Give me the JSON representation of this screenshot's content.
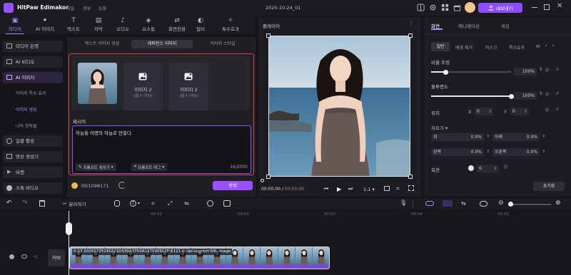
{
  "app": {
    "title": "HitPaw Edimakor",
    "menu": [
      "파일",
      "생성",
      "도움"
    ],
    "project_name": "2025-10-24_01",
    "export_label": "내보내기"
  },
  "toolbar": {
    "tools": [
      {
        "label": "미디어",
        "icon": "media-icon",
        "active": true
      },
      {
        "label": "AI 이미지",
        "icon": "ai-image-icon"
      },
      {
        "label": "텍스트",
        "icon": "text-icon"
      },
      {
        "label": "자막",
        "icon": "subtitle-icon"
      },
      {
        "label": "오디오",
        "icon": "audio-icon"
      },
      {
        "label": "요소들",
        "icon": "elements-icon"
      },
      {
        "label": "화면전환",
        "icon": "transition-icon"
      },
      {
        "label": "필터",
        "icon": "filter-icon"
      },
      {
        "label": "특수효과",
        "icon": "effects-icon"
      }
    ]
  },
  "sidebar": {
    "items": [
      {
        "label": "미디어 은행"
      },
      {
        "label": "AI 비디오"
      },
      {
        "label": "AI 이미지",
        "active": true
      }
    ],
    "subitems": [
      "이미지 특수 효과",
      "이미지 생성",
      "나의 창작물"
    ],
    "items_bottom": [
      {
        "label": "일괄 활성"
      },
      {
        "label": "영상 생성기"
      },
      {
        "label": "비켄"
      },
      {
        "label": "스톡 비디오"
      }
    ]
  },
  "panel": {
    "tabs": [
      "텍스트 이미지 생성",
      "레퍼런스 이미지",
      "이미지 스타일"
    ],
    "active_tab": 1,
    "image_slots": [
      {
        "label": "이미지 2",
        "sub": "(필수 아님)"
      },
      {
        "label": "이미지 2",
        "sub": "(필수 아님)"
      }
    ],
    "prompt_title": "제시어",
    "prompt_text": "하늘을 여명의 하늘로 만들다.",
    "prompt_gen_label": "프롬프트 생성기",
    "prompt_tag_label": "프롬프트 태그",
    "char_count": "16/2000",
    "credits": "30/1098171",
    "generate_label": "생성"
  },
  "player": {
    "title": "플레이어",
    "time_current": "00:00:00",
    "time_total": "00:03:00",
    "ratio": "1:1"
  },
  "right_panel": {
    "tabs": [
      "화면",
      "애니메이션",
      "색상"
    ],
    "subtabs": [
      "일반",
      "배경 제거",
      "마스크",
      "특수효과",
      "AI"
    ],
    "scale_label": "비율 조정",
    "scale_value": 1.0,
    "scale_text": "100%",
    "opacity_label": "불투명도",
    "opacity_value": 1.0,
    "opacity_text": "100%",
    "position_label": "위치",
    "pos_x_label": "X",
    "pos_x": "0",
    "pos_y_label": "Y",
    "pos_y": "0",
    "crop_label": "자르기",
    "crop": [
      {
        "label": "위",
        "value": "0.0%"
      },
      {
        "label": "아래",
        "value": "0.0%"
      },
      {
        "label": "왼쪽",
        "value": "0.0%"
      },
      {
        "label": "오른쪽",
        "value": "0.0%"
      }
    ],
    "rotate_label": "회전",
    "rotate_value": "0",
    "reset_label": "초기화"
  },
  "timeline": {
    "split_label": "분리하기",
    "ticks": [
      "00:01",
      "00:02",
      "00:03",
      "00:04",
      "00:05"
    ],
    "track_label": "커버",
    "clip_label": "0:03  20250725141821D539A3702A197190502F-6121-0--tpl-vugnort-59l--mage"
  }
}
